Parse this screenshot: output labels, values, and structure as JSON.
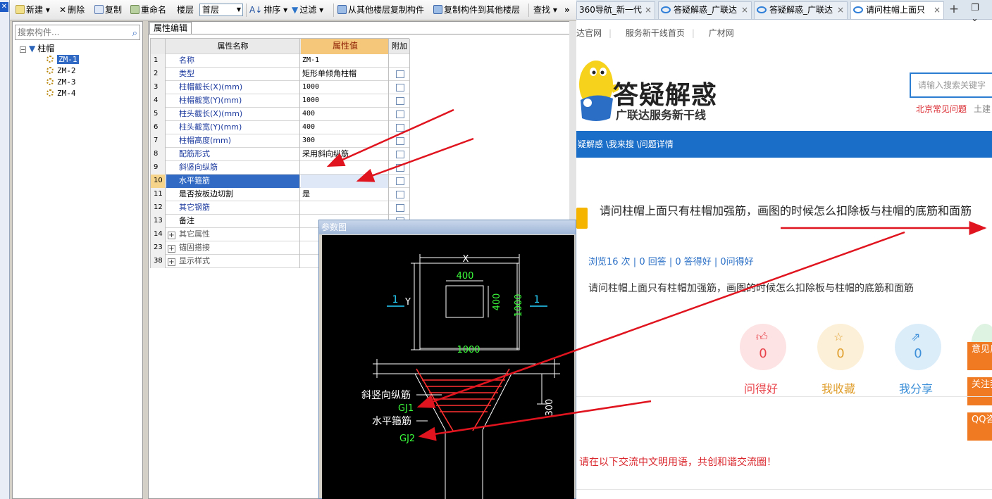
{
  "toolbar": {
    "new": "新建",
    "delete": "删除",
    "copy": "复制",
    "rename": "重命名",
    "floor_label": "楼层",
    "floor_value": "首层",
    "sort": "排序",
    "filter": "过滤",
    "copy_from_floor": "从其他楼层复制构件",
    "copy_to_floor": "复制构件到其他楼层",
    "find": "查找",
    "more": "»"
  },
  "tree": {
    "search_placeholder": "搜索构件...",
    "root": "柱帽",
    "items": [
      "ZM-1",
      "ZM-2",
      "ZM-3",
      "ZM-4"
    ],
    "selected": "ZM-1"
  },
  "props": {
    "tab": "属性编辑",
    "headers": {
      "name": "属性名称",
      "value": "属性值",
      "extra": "附加"
    },
    "rows": [
      {
        "no": "1",
        "name": "名称",
        "value": "ZM-1"
      },
      {
        "no": "2",
        "name": "类型",
        "value": "矩形单倾角柱帽"
      },
      {
        "no": "3",
        "name": "柱帽截长(X)(mm)",
        "value": "1000"
      },
      {
        "no": "4",
        "name": "柱帽截宽(Y)(mm)",
        "value": "1000"
      },
      {
        "no": "5",
        "name": "柱头截长(X)(mm)",
        "value": "400"
      },
      {
        "no": "6",
        "name": "柱头截宽(Y)(mm)",
        "value": "400"
      },
      {
        "no": "7",
        "name": "柱帽高度(mm)",
        "value": "300"
      },
      {
        "no": "8",
        "name": "配筋形式",
        "value": "采用斜向纵筋"
      },
      {
        "no": "9",
        "name": "斜竖向纵筋",
        "value": ""
      },
      {
        "no": "10",
        "name": "水平箍筋",
        "value": ""
      },
      {
        "no": "11",
        "name": "是否按板边切割",
        "value": "是"
      },
      {
        "no": "12",
        "name": "其它钢筋",
        "value": ""
      },
      {
        "no": "13",
        "name": "备注",
        "value": ""
      },
      {
        "no": "14",
        "name": "其它属性",
        "value": ""
      },
      {
        "no": "23",
        "name": "锚固搭接",
        "value": ""
      },
      {
        "no": "38",
        "name": "显示样式",
        "value": ""
      }
    ]
  },
  "diagram": {
    "title": "参数图",
    "labels": {
      "x": "X",
      "y": "Y",
      "inner_w": "400",
      "inner_h": "400",
      "outer_w": "1000",
      "outer_h": "1000",
      "sec_left": "1",
      "sec_right": "1",
      "height": "300",
      "diag_bar": "斜竖向纵筋",
      "gj1": "GJ1",
      "horiz_bar": "水平箍筋",
      "gj2": "GJ2"
    }
  },
  "browser": {
    "tabs": [
      {
        "label": "360导航_新一代"
      },
      {
        "label": "答疑解惑_广联达"
      },
      {
        "label": "答疑解惑_广联达"
      },
      {
        "label": "请问柱帽上面只"
      }
    ],
    "tab_close": "×",
    "new_tab": "+",
    "nav_links": [
      "达官网",
      "服务新干线首页",
      "广材网"
    ],
    "logo_title": "答疑解惑",
    "logo_sub": "广联达服务新干线",
    "search_placeholder": "请输入搜索关键字",
    "hot_links": [
      "北京常见问题",
      "土建"
    ],
    "breadcrumb": "疑解惑 \\我来搜 \\问题详情",
    "question_title": "请问柱帽上面只有柱帽加强筋，画图的时候怎么扣除板与柱帽的底筋和面筋",
    "stats": "浏览16 次 | 0 回答 | 0 答得好 | 0问得好",
    "question_body": "请问柱帽上面只有柱帽加强筋，画图的时候怎么扣除板与柱帽的底筋和面筋",
    "actions": [
      {
        "label": "问得好",
        "count": "0",
        "color": "#e8434a",
        "bg": "#fde3e4",
        "icon": "thumbs-up-icon"
      },
      {
        "label": "我收藏",
        "count": "0",
        "color": "#e0a030",
        "bg": "#fdf0d8",
        "icon": "star-icon"
      },
      {
        "label": "我分享",
        "count": "0",
        "color": "#3c8fd8",
        "bg": "#dcedfa",
        "icon": "share-icon"
      }
    ],
    "side_buttons": [
      "意见反馈",
      "关注我们",
      "QQ咨询"
    ],
    "civil_note": "请在以下交流中文明用语，共创和谐交流圈！"
  },
  "colors": {
    "accent_blue": "#1a6ec8",
    "arrow_red": "#e0141e",
    "orange": "#f07a22"
  }
}
